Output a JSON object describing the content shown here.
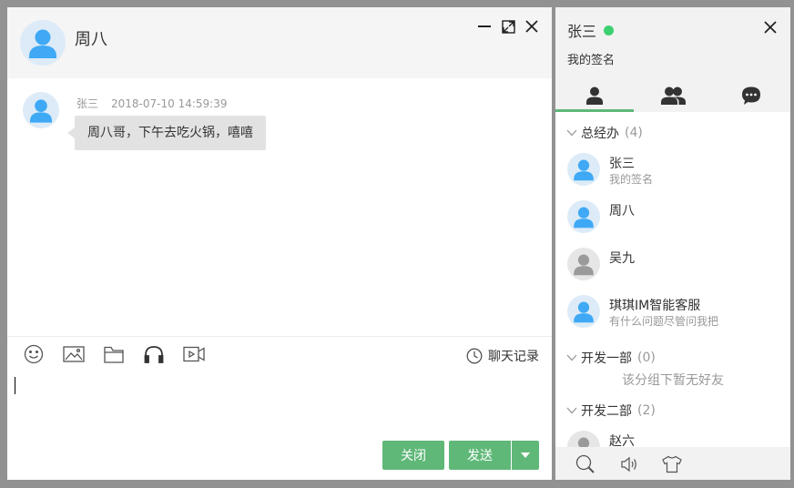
{
  "chat": {
    "title": "周八",
    "window_buttons": [
      "minimize-icon",
      "maximize-icon",
      "close-icon"
    ],
    "messages": [
      {
        "sender": "张三",
        "time": "2018-07-10 14:59:39",
        "text": "周八哥，下午去吃火锅，嘻嘻"
      }
    ],
    "toolbar": {
      "icons": [
        "emoji-icon",
        "image-icon",
        "folder-icon",
        "headphones-icon",
        "video-icon"
      ],
      "history_label": "聊天记录"
    },
    "input_value": "",
    "buttons": {
      "close_label": "关闭",
      "send_label": "发送"
    }
  },
  "panel": {
    "user_name": "张三",
    "status": "online",
    "signature": "我的签名",
    "tabs": [
      "friends-tab-icon",
      "groups-tab-icon",
      "history-tab-icon"
    ],
    "active_tab": 0,
    "groups": [
      {
        "name": "总经办",
        "count": "(4)",
        "friends": [
          {
            "name": "张三",
            "sign": "我的签名",
            "online": true
          },
          {
            "name": "周八",
            "sign": "",
            "online": true
          },
          {
            "name": "吴九",
            "sign": "",
            "online": false
          },
          {
            "name": "琪琪IM智能客服",
            "sign": "有什么问题尽管问我把",
            "online": true
          }
        ]
      },
      {
        "name": "开发一部",
        "count": "(0)",
        "empty_text": "该分组下暂无好友"
      },
      {
        "name": "开发二部",
        "count": "(2)",
        "friends": [
          {
            "name": "赵六",
            "sign": "",
            "online": false
          }
        ]
      }
    ],
    "footer_icons": [
      "search-icon",
      "sound-icon",
      "skin-icon"
    ]
  },
  "colors": {
    "accent": "#5FB878",
    "online": "#3CD071",
    "avatar_online": "#3FA9F5",
    "avatar_offline": "#9A9A9A",
    "bubble": "#E2E2E2"
  }
}
